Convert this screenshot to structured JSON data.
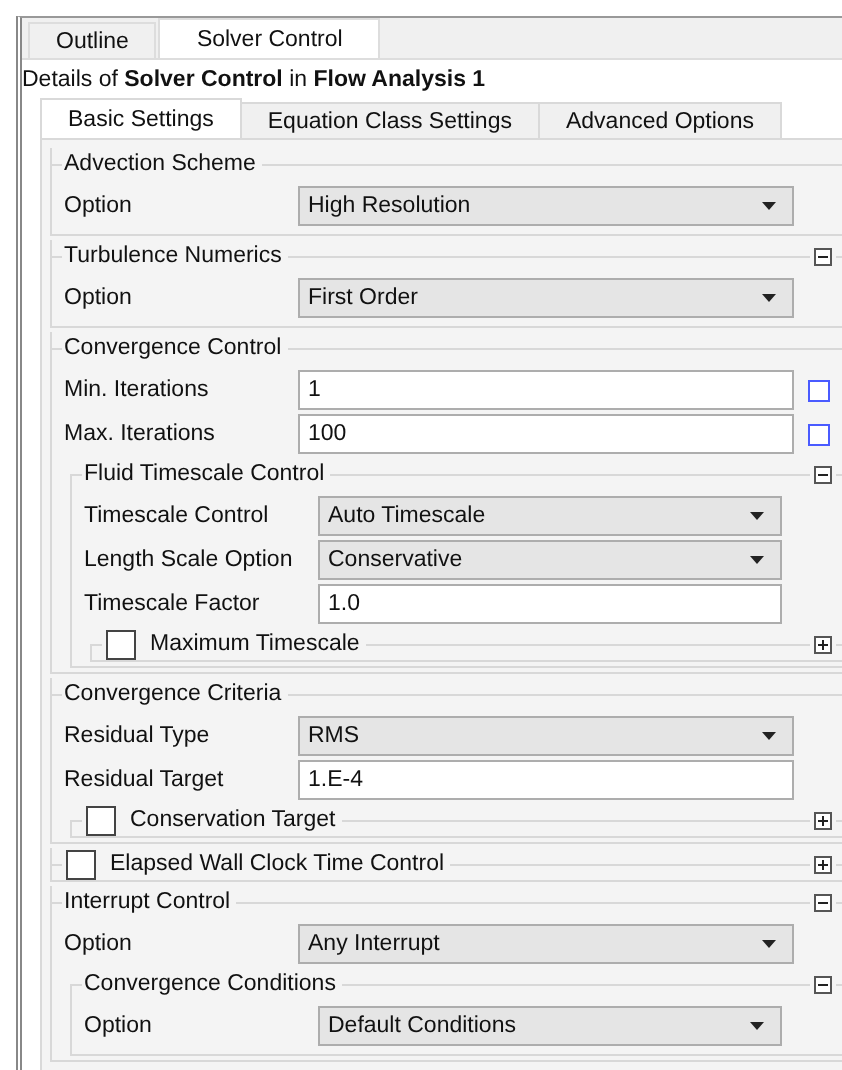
{
  "top_tabs": [
    {
      "label": "Outline",
      "selected": false
    },
    {
      "label": "Solver Control",
      "selected": true
    }
  ],
  "details": "Details of **Solver Control** in **Flow Analysis 1**",
  "tabs": [
    {
      "label": "Basic Settings",
      "selected": true
    },
    {
      "label": "Equation Class Settings",
      "selected": false
    },
    {
      "label": "Advanced Options",
      "selected": false
    }
  ],
  "sections": [
    {
      "title": "Advection Scheme",
      "rows": [
        {
          "kind": "select",
          "label": "Option",
          "value": "High Resolution"
        }
      ]
    },
    {
      "title": "Turbulence Numerics",
      "expanded": true,
      "rows": [
        {
          "kind": "select",
          "label": "Option",
          "value": "First Order"
        }
      ]
    },
    {
      "title": "Convergence Control",
      "rows": [
        {
          "kind": "input",
          "label": "Min. Iterations",
          "value": "1",
          "side_checked": false
        },
        {
          "kind": "input",
          "label": "Max. Iterations",
          "value": "100",
          "side_checked": false
        }
      ],
      "children": [
        {
          "title": "Fluid Timescale Control",
          "expanded": true,
          "rows": [
            {
              "kind": "select",
              "label": "Timescale Control",
              "value": "Auto Timescale"
            },
            {
              "kind": "select",
              "label": "Length Scale Option",
              "value": "Conservative"
            },
            {
              "kind": "input",
              "label": "Timescale Factor",
              "value": "1.0"
            }
          ],
          "children": [
            {
              "title": "Maximum Timescale",
              "checked": false,
              "expanded": false
            }
          ]
        }
      ]
    },
    {
      "title": "Convergence Criteria",
      "rows": [
        {
          "kind": "select",
          "label": "Residual Type",
          "value": "RMS"
        },
        {
          "kind": "input",
          "label": "Residual Target",
          "value": "1.E-4"
        }
      ],
      "children": [
        {
          "title": "Conservation Target",
          "checked": false,
          "expanded": false
        }
      ]
    },
    {
      "title": "Elapsed Wall Clock Time Control",
      "checked": false,
      "expanded": false
    },
    {
      "title": "Interrupt Control",
      "expanded": true,
      "rows": [
        {
          "kind": "select",
          "label": "Option",
          "value": "Any Interrupt"
        }
      ],
      "children": [
        {
          "title": "Convergence Conditions",
          "expanded": true,
          "rows": [
            {
              "kind": "select",
              "label": "Option",
              "value": "Default Conditions"
            }
          ]
        }
      ]
    }
  ]
}
